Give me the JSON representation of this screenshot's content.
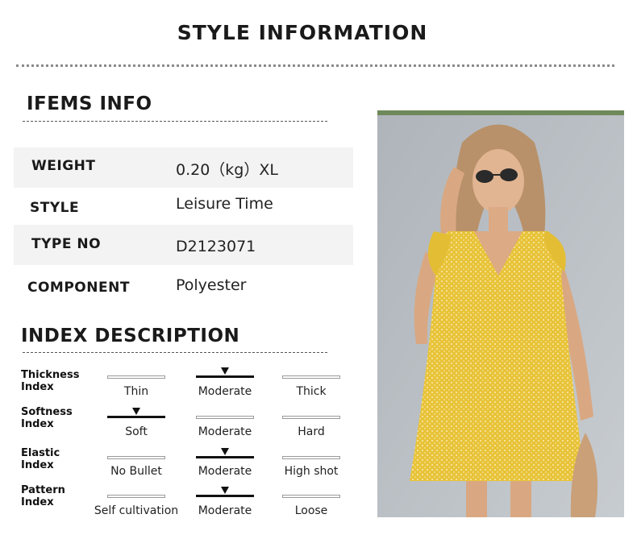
{
  "page_title": "STYLE INFORMATION",
  "items_info": {
    "heading": "IFEMS INFO",
    "rows": [
      {
        "label": "WEIGHT",
        "value": "0.20（kg）XL"
      },
      {
        "label": "STYLE",
        "value": "Leisure Time"
      },
      {
        "label": "TYPE NO",
        "value": "D2123071"
      },
      {
        "label": "COMPONENT",
        "value": "Polyester"
      }
    ]
  },
  "index_description": {
    "heading": "INDEX DESCRIPTION",
    "indices": [
      {
        "label_line1": "Thickness",
        "label_line2": "Index",
        "options": [
          "Thin",
          "Moderate",
          "Thick"
        ],
        "selected": 1
      },
      {
        "label_line1": "Softness",
        "label_line2": "Index",
        "options": [
          "Soft",
          "Moderate",
          "Hard"
        ],
        "selected": 0
      },
      {
        "label_line1": "Elastic",
        "label_line2": "Index",
        "options": [
          "No Bullet",
          "Moderate",
          "High shot"
        ],
        "selected": 1
      },
      {
        "label_line1": "Pattern",
        "label_line2": "Index",
        "options": [
          "Self cultivation",
          "Moderate",
          "Loose"
        ],
        "selected": 1
      }
    ]
  },
  "photo": {
    "subject": "model-in-yellow-floral-dress"
  }
}
